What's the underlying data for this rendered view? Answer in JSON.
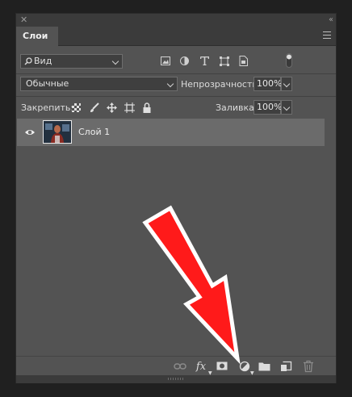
{
  "panel": {
    "tab_label": "Слои"
  },
  "filter": {
    "kind_label": "Вид"
  },
  "blend": {
    "mode_label": "Обычные",
    "opacity_label": "Непрозрачность:",
    "opacity_value": "100%"
  },
  "lock": {
    "label": "Закрепить:",
    "fill_label": "Заливка:",
    "fill_value": "100%"
  },
  "layers": [
    {
      "name": "Слой 1",
      "visible": true,
      "selected": true
    }
  ],
  "footer": {
    "fx_label": "fx"
  },
  "colors": {
    "panel_bg": "#535353",
    "selected_layer": "#6b6b6b",
    "annotation_arrow": "#ff0000"
  }
}
